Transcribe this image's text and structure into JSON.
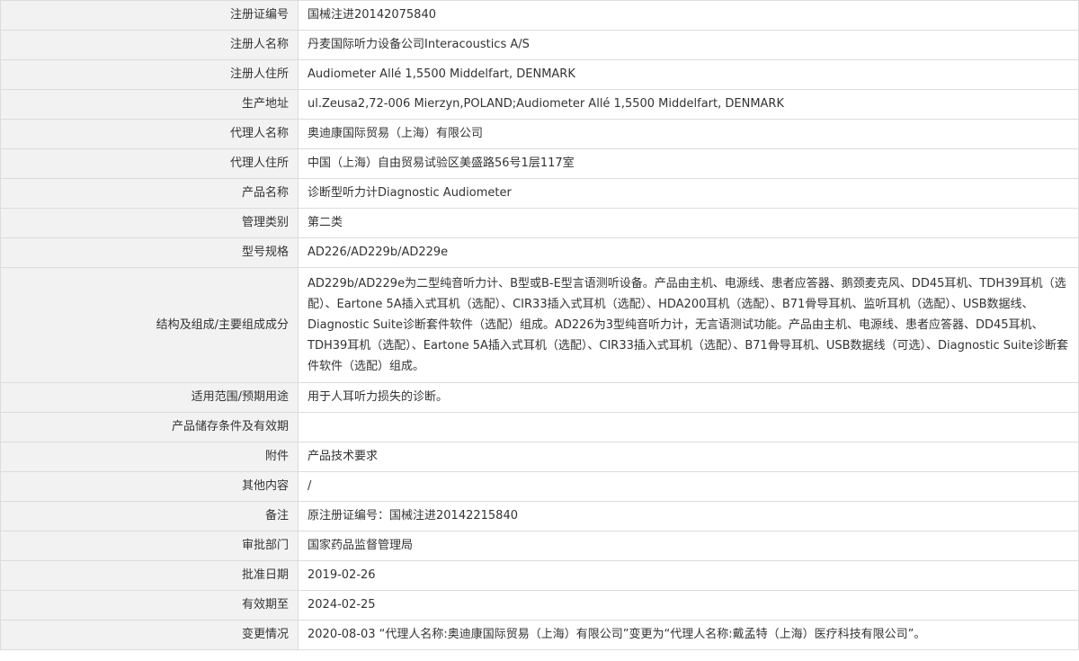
{
  "rows": [
    {
      "label": "注册证编号",
      "value": "国械注进20142075840"
    },
    {
      "label": "注册人名称",
      "value": "丹麦国际听力设备公司Interacoustics A/S"
    },
    {
      "label": "注册人住所",
      "value": "Audiometer Allé 1,5500 Middelfart, DENMARK"
    },
    {
      "label": "生产地址",
      "value": "ul.Zeusa2,72-006 Mierzyn,POLAND;Audiometer Allé 1,5500 Middelfart, DENMARK"
    },
    {
      "label": "代理人名称",
      "value": "奥迪康国际贸易（上海）有限公司"
    },
    {
      "label": "代理人住所",
      "value": "中国（上海）自由贸易试验区美盛路56号1层117室"
    },
    {
      "label": "产品名称",
      "value": "诊断型听力计Diagnostic Audiometer"
    },
    {
      "label": "管理类别",
      "value": "第二类"
    },
    {
      "label": "型号规格",
      "value": "AD226/AD229b/AD229e"
    },
    {
      "label": "结构及组成/主要组成成分",
      "value": "AD229b/AD229e为二型纯音听力计、B型或B-E型言语测听设备。产品由主机、电源线、患者应答器、鹅颈麦克风、DD45耳机、TDH39耳机（选配）、Eartone 5A插入式耳机（选配）、CIR33插入式耳机（选配）、HDA200耳机（选配）、B71骨导耳机、监听耳机（选配）、USB数据线、Diagnostic Suite诊断套件软件（选配）组成。AD226为3型纯音听力计，无言语测试功能。产品由主机、电源线、患者应答器、DD45耳机、TDH39耳机（选配）、Eartone 5A插入式耳机（选配）、CIR33插入式耳机（选配）、B71骨导耳机、USB数据线（可选）、Diagnostic Suite诊断套件软件（选配）组成。"
    },
    {
      "label": "适用范围/预期用途",
      "value": "用于人耳听力损失的诊断。"
    },
    {
      "label": "产品储存条件及有效期",
      "value": ""
    },
    {
      "label": "附件",
      "value": "产品技术要求"
    },
    {
      "label": "其他内容",
      "value": "/"
    },
    {
      "label": "备注",
      "value": "原注册证编号：国械注进20142215840"
    },
    {
      "label": "审批部门",
      "value": "国家药品监督管理局"
    },
    {
      "label": "批准日期",
      "value": "2019-02-26"
    },
    {
      "label": "有效期至",
      "value": "2024-02-25"
    },
    {
      "label": "变更情况",
      "value": "2020-08-03 “代理人名称:奥迪康国际贸易（上海）有限公司”变更为“代理人名称:戴孟特（上海）医疗科技有限公司”。"
    }
  ]
}
